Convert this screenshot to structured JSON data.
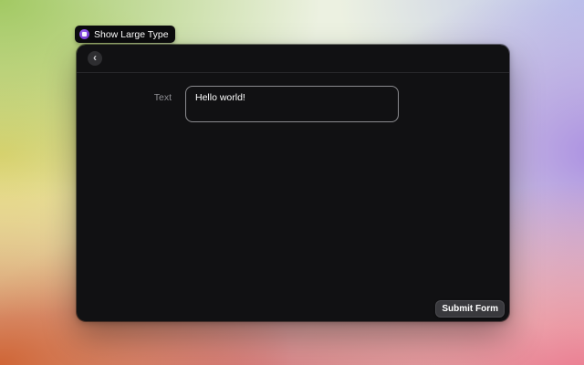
{
  "tooltip": {
    "label": "Show Large Type",
    "icon": "large-type-extension-icon",
    "icon_color": "#7c3fd8"
  },
  "window": {
    "header": {
      "back_icon": "‹"
    },
    "form": {
      "fields": [
        {
          "label": "Text",
          "value": "Hello world!"
        }
      ]
    },
    "submit_button": {
      "label": "Submit Form"
    }
  },
  "colors": {
    "window_background": "#111113",
    "header_divider": "#27272a",
    "field_border": "#8b8b8f",
    "label_text": "#8e8e93",
    "submit_button_background": "#39393d",
    "tooltip_background": "#0c0c0e",
    "tooltip_icon_purple": "#7c3fd8",
    "backdrop_green": "#9ec75c",
    "backdrop_yellow": "#e5d36c",
    "backdrop_orange": "#ce5f2e",
    "backdrop_rose": "#d15c66",
    "backdrop_pink": "#eb6983",
    "backdrop_purple": "#a78ae2",
    "backdrop_lavender": "#bbc2ec"
  }
}
